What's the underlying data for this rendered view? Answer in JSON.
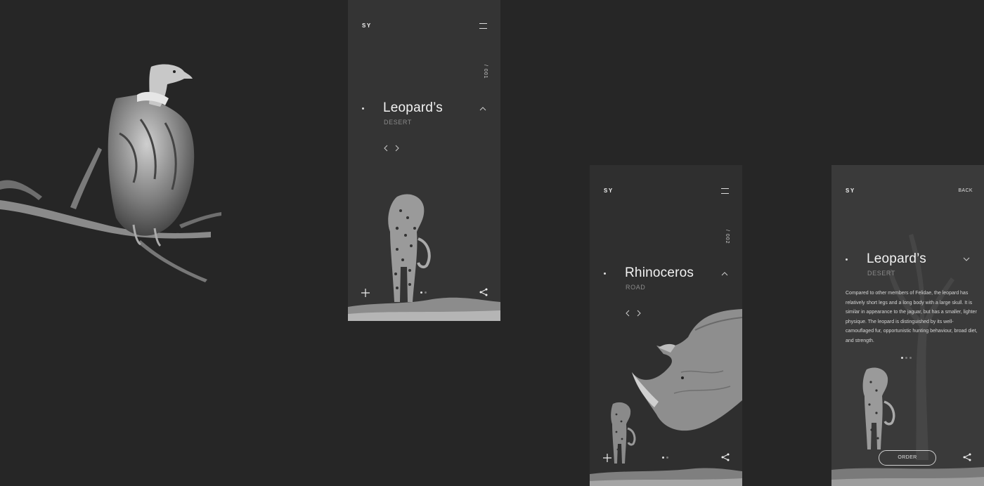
{
  "screens": [
    {
      "logo": "SY",
      "counter": "/ 001",
      "title": "Leopard’s",
      "subtitle": "DESERT"
    },
    {
      "logo": "SY",
      "counter": "/ 002",
      "title": "Rhinoceros",
      "subtitle": "ROAD"
    },
    {
      "logo": "SY",
      "back_label": "BACK",
      "title": "Leopard’s",
      "subtitle": "DESERT",
      "description": "Compared to other members of Felidae, the leopard has relatively short legs and a long body with a large skull. It is similar in appearance to the jaguar, but has a smaller, lighter physique. The leopard is distinguished by its well-camouflaged fur, opportunistic hunting behaviour, broad diet, and strength.",
      "order_label": "ORDER"
    }
  ],
  "icons": {
    "menu": "hamburger-menu-icon",
    "expand": "chevron-up-icon",
    "collapse": "chevron-down-icon",
    "prev": "chevron-left-icon",
    "next": "chevron-right-icon",
    "add": "plus-icon",
    "share": "share-icon"
  }
}
